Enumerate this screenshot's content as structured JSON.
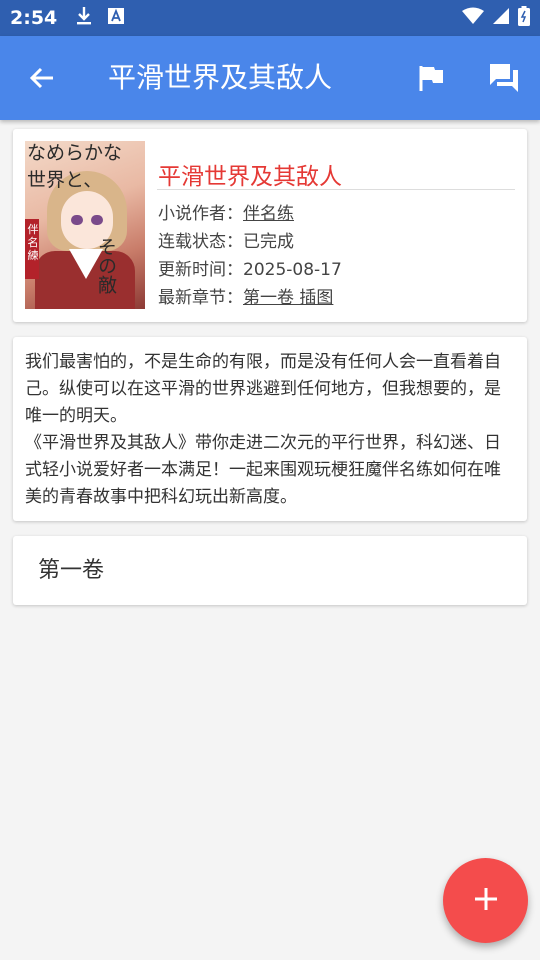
{
  "status_bar": {
    "time": "2:54"
  },
  "app_bar": {
    "title": "平滑世界及其敌人",
    "back_icon": "arrow-back-icon",
    "flag_icon": "flag-icon",
    "chat_icon": "forum-icon"
  },
  "book": {
    "cover_text_top": "なめらかな",
    "cover_text_mid": "世界と、",
    "cover_author": "伴名練",
    "cover_subtitle": "その敵",
    "title": "平滑世界及其敌人",
    "author_label": "小说作者：",
    "author": "伴名练",
    "status_label": "连载状态：",
    "status": "已完成",
    "update_label": "更新时间：",
    "update": "2025-08-17",
    "latest_label": "最新章节：",
    "latest": "第一卷 插图"
  },
  "description": {
    "p1": "我们最害怕的，不是生命的有限，而是没有任何人会一直看着自己。纵使可以在这平滑的世界逃避到任何地方，但我想要的，是唯一的明天。",
    "p2": "《平滑世界及其敌人》带你走进二次元的平行世界，科幻迷、日式轻小说爱好者一本满足！一起来围观玩梗狂魔伴名练如何在唯美的青春故事中把科幻玩出新高度。"
  },
  "volume": {
    "label": "第一卷"
  },
  "fab": {
    "icon": "add-icon"
  },
  "colors": {
    "app_bar": "#4a86ea",
    "status_bar": "#2f5fb0",
    "title_red": "#e53935",
    "fab": "#f44c4c"
  }
}
